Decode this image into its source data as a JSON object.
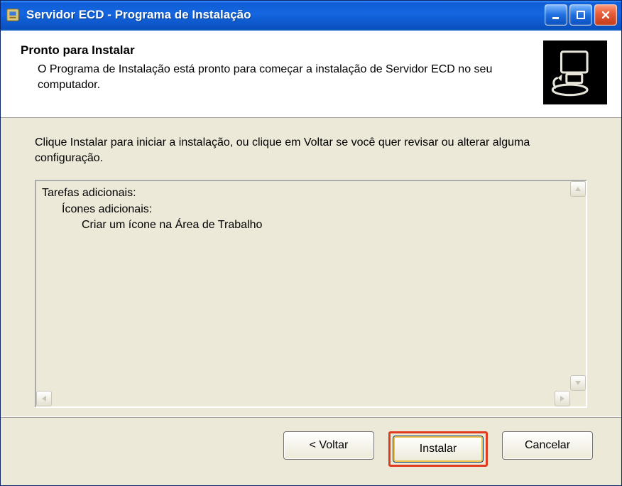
{
  "window": {
    "title": "Servidor ECD - Programa de Instalação"
  },
  "header": {
    "title": "Pronto para Instalar",
    "subtitle": "O Programa de Instalação está pronto para começar a instalação de Servidor ECD no seu computador."
  },
  "body": {
    "instructions": "Clique Instalar para iniciar a instalação, ou clique em Voltar se você quer revisar ou alterar alguma configuração.",
    "summary": {
      "line1": "Tarefas adicionais:",
      "line2": "Ícones adicionais:",
      "line3": "Criar um ícone na Área de Trabalho"
    }
  },
  "footer": {
    "back": "< Voltar",
    "install": "Instalar",
    "cancel": "Cancelar"
  },
  "icons": {
    "titlebar": "installer-icon",
    "header": "computer-install-icon"
  }
}
